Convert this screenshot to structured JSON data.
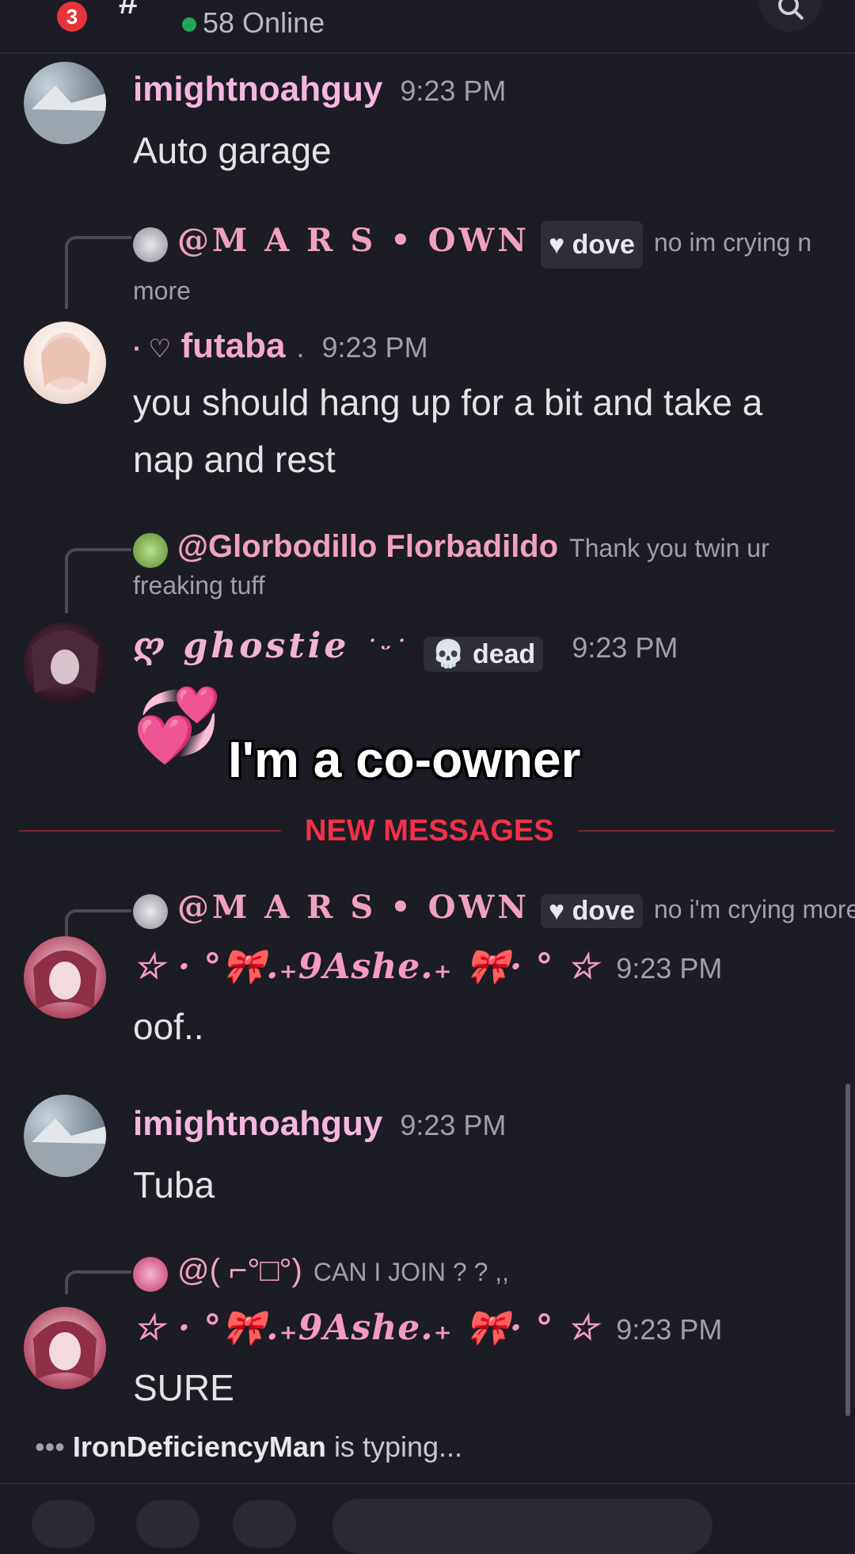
{
  "header": {
    "notification_count": "3",
    "channel_glyph": "#",
    "online_text": "58 Online",
    "search_icon": "search-icon"
  },
  "messages": [
    {
      "user": "imightnoahguy",
      "time": "9:23 PM",
      "body": "Auto garage",
      "name_color": "#f5b6df"
    },
    {
      "reply_to": "@M A R S • OWN",
      "reply_tag": "dove",
      "reply_text": "no im crying n more",
      "user_prefix": "· ♡",
      "user": "futaba",
      "user_suffix": ".",
      "time": "9:23 PM",
      "body": "you should hang up for a bit and take a nap and rest",
      "name_color": "#f4a8d0"
    },
    {
      "reply_to": "@Glorbodillo Florbadildo",
      "reply_text": "Thank you twin ur freaking tuff",
      "user_prefix": "ღ",
      "user": "ghostie",
      "user_suffix": "˙ᵕ˙",
      "tag": "dead",
      "time": "9:23 PM",
      "body": "💞",
      "name_color": "#f2b3d2"
    },
    {
      "reply_to": "@M A R S • OWN",
      "reply_tag": "dove",
      "reply_text": "no i'm crying more",
      "user": "☆ · °🎀.₊9Ashe.₊ 🎀· ° ☆",
      "time": "9:23 PM",
      "body": "oof..",
      "name_color": "#f49ac4"
    },
    {
      "user": "imightnoahguy",
      "time": "9:23 PM",
      "body": "Tuba",
      "name_color": "#f5b6df"
    },
    {
      "reply_to": "@( ⌐°□°)",
      "reply_text": "CAN I JOIN ? ? ,,",
      "user": "☆ · °🎀.₊9Ashe.₊ 🎀· ° ☆",
      "time": "9:23 PM",
      "body": "SURE",
      "name_color": "#f49ac4"
    }
  ],
  "divider": {
    "label": "NEW MESSAGES"
  },
  "overlay_caption": "I'm a co-owner",
  "typing": {
    "user": "IronDeficiencyMan",
    "text": "is typing..."
  }
}
